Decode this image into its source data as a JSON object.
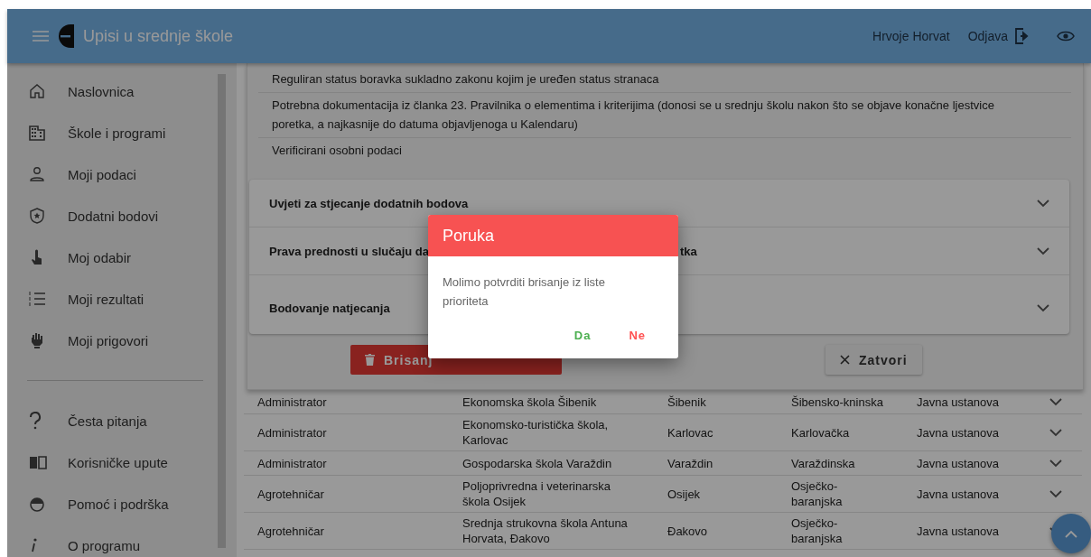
{
  "header": {
    "title": "Upisi u srednje škole",
    "user": "Hrvoje Horvat",
    "logout": "Odjava"
  },
  "sidebar": {
    "items": [
      {
        "label": "Naslovnica"
      },
      {
        "label": "Škole i programi"
      },
      {
        "label": "Moji podaci"
      },
      {
        "label": "Dodatni bodovi"
      },
      {
        "label": "Moj odabir"
      },
      {
        "label": "Moji rezultati"
      },
      {
        "label": "Moji prigovori"
      }
    ],
    "help_items": [
      {
        "label": "Česta pitanja"
      },
      {
        "label": "Korisničke upute"
      },
      {
        "label": "Pomoć i podrška"
      },
      {
        "label": "O programu"
      }
    ]
  },
  "requirements": [
    "Reguliran status boravka sukladno zakonu kojim je uređen status stranaca",
    "Potrebna dokumentacija iz članka 23. Pravilnika o elementima i kriterijima (donosi se u srednju školu nakon što se objave konačne ljestvice poretka, a najkasnije do datuma objavljenoga u Kalendaru)",
    "Verificirani osobni podaci"
  ],
  "accordions": [
    {
      "title": "Uvjeti za stjecanje dodatnih bodova"
    },
    {
      "title": "Prava prednosti u slučaju da",
      "title_end": "tka"
    },
    {
      "title": "Bodovanje natjecanja"
    }
  ],
  "actions": {
    "delete": "Brisanj",
    "close": "Zatvori"
  },
  "table": {
    "rows": [
      {
        "cells": [
          "Administrator",
          "Ekonomska škola Šibenik",
          "Šibenik",
          "Šibensko-kninska",
          "Javna ustanova"
        ]
      },
      {
        "cells": [
          "Administrator",
          "Ekonomsko-turistička škola, Karlovac",
          "Karlovac",
          "Karlovačka",
          "Javna ustanova"
        ]
      },
      {
        "cells": [
          "Administrator",
          "Gospodarska škola Varaždin",
          "Varaždin",
          "Varaždinska",
          "Javna ustanova"
        ]
      },
      {
        "cells": [
          "Agrotehničar",
          "Poljoprivredna i veterinarska škola Osijek",
          "Osijek",
          "Osječko-baranjska",
          "Javna ustanova"
        ]
      },
      {
        "cells": [
          "Agrotehničar",
          "Srednja strukovna škola Antuna Horvata, Đakovo",
          "Đakovo",
          "Osječko-baranjska",
          "Javna ustanova"
        ]
      }
    ]
  },
  "dialog": {
    "title": "Poruka",
    "message": "Molimo potvrditi brisanje iz liste prioriteta",
    "confirm": "Da",
    "cancel": "Ne"
  }
}
